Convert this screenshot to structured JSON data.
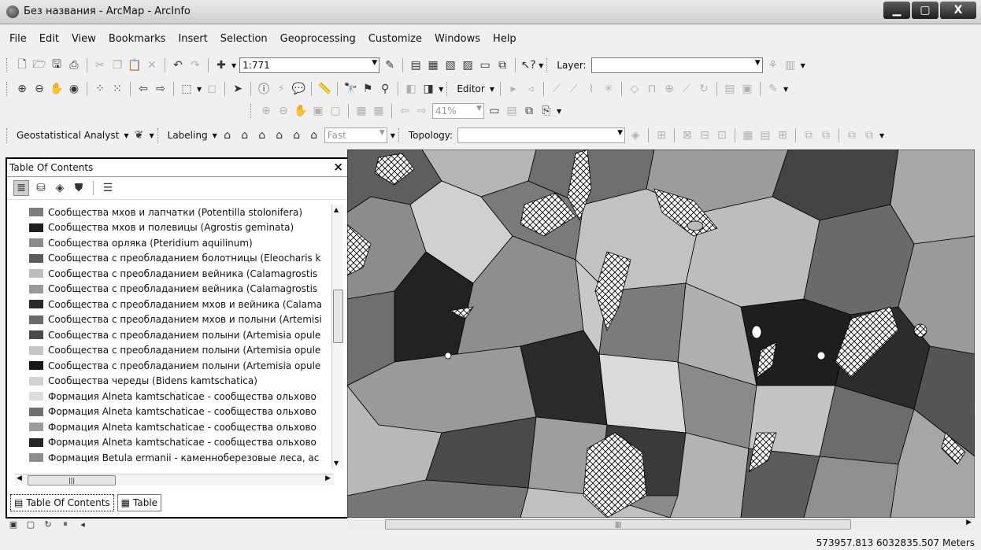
{
  "window": {
    "title": "Без названия - ArcMap - ArcInfo"
  },
  "menu": [
    "File",
    "Edit",
    "View",
    "Bookmarks",
    "Insert",
    "Selection",
    "Geoprocessing",
    "Customize",
    "Windows",
    "Help"
  ],
  "standard_toolbar": {
    "scale": "1:771",
    "layer_label": "Layer:"
  },
  "editor_toolbar": {
    "editor_label": "Editor"
  },
  "layout_toolbar": {
    "zoom_percent": "41%"
  },
  "geostat_toolbar": {
    "label": "Geostatistical Analyst"
  },
  "labeling_toolbar": {
    "label": "Labeling",
    "mode": "Fast"
  },
  "topology_toolbar": {
    "label": "Topology:"
  },
  "toc": {
    "title": "Table Of Contents",
    "items": [
      {
        "label": "Сообщества мхов и лапчатки (Potentilla stolonifera)",
        "color": "#7c7c7c"
      },
      {
        "label": "Сообщества мхов и полевицы (Agrostis geminata)",
        "color": "#1e1e1e"
      },
      {
        "label": "Сообщества орляка (Pteridium aquilinum)",
        "color": "#8a8a8a"
      },
      {
        "label": "Сообщества с преобладанием болотницы (Eleocharis k",
        "color": "#5a5a5a"
      },
      {
        "label": "Сообщества с преобладанием вейника (Calamagrostis",
        "color": "#bdbdbd"
      },
      {
        "label": "Сообщества с преобладанием вейника (Calamagrostis",
        "color": "#9a9a9a"
      },
      {
        "label": "Сообщества с преобладанием мхов и вейника (Calama",
        "color": "#2a2a2a"
      },
      {
        "label": "Сообщества с преобладанием мхов и полыни (Artemisi",
        "color": "#6a6a6a"
      },
      {
        "label": "Сообщества с преобладанием полыни (Artemisia opule",
        "color": "#4a4a4a"
      },
      {
        "label": "Сообщества с преобладанием полыни (Artemisia opule",
        "color": "#c6c6c6"
      },
      {
        "label": "Сообщества с преобладанием полыни (Artemisia opule",
        "color": "#161616"
      },
      {
        "label": "Сообщества череды (Bidens kamtschatica)",
        "color": "#d2d2d2"
      },
      {
        "label": "Формация Alneta kamtschaticae - сообщества ольхово",
        "color": "#dcdcdc"
      },
      {
        "label": "Формация Alneta kamtschaticae - сообщества ольхово",
        "color": "#707070"
      },
      {
        "label": "Формация Alneta kamtschaticae - сообщества ольхово",
        "color": "#9c9c9c"
      },
      {
        "label": "Формация Alneta kamtschaticae - сообщества ольхово",
        "color": "#262626"
      },
      {
        "label": "Формация Betula ermanii - каменноберезовые леса, ас",
        "color": "#8e8e8e"
      }
    ],
    "tabs": [
      "Table Of Contents",
      "Table"
    ]
  },
  "status": {
    "coordinates": "573957.813  6032835.507 Meters"
  }
}
